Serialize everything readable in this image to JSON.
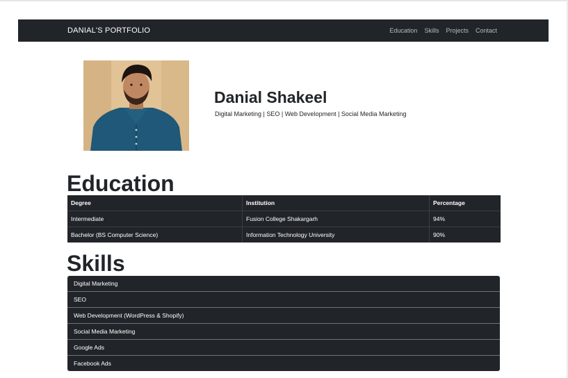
{
  "nav": {
    "brand": "DANIAL'S PORTFOLIO",
    "links": [
      "Education",
      "Skills",
      "Projects",
      "Contact"
    ]
  },
  "profile": {
    "name": "Danial Shakeel",
    "tagline": "Digital Marketing | SEO | Web Development | Social Media Marketing"
  },
  "education": {
    "title": "Education",
    "headers": [
      "Degree",
      "Institution",
      "Percentage"
    ],
    "rows": [
      [
        "Intermediate",
        "Fusion College Shakargarh",
        "94%"
      ],
      [
        "Bachelor (BS Computer Science)",
        "Information Technology University",
        "90%"
      ]
    ]
  },
  "skills": {
    "title": "Skills",
    "items": [
      "Digital Marketing",
      "SEO",
      "Web Development (WordPress & Shopify)",
      "Social Media Marketing",
      "Google Ads",
      "Facebook Ads"
    ]
  },
  "colors": {
    "dark": "#212529",
    "nav_link": "#b8bcc0",
    "page_bg": "#ffffff"
  }
}
